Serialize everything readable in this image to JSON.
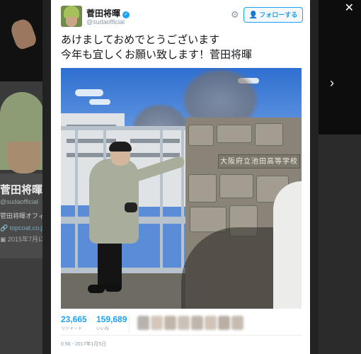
{
  "background": {
    "profile_name": "菅田将暉",
    "profile_handle": "@sudaofficial",
    "profile_bio": "菅田将暉オフィ",
    "profile_link": "topcoat.co.jp",
    "profile_joined": "2015年7月に",
    "close_icon": "close-icon",
    "next_icon": "chevron-right-icon"
  },
  "tweet": {
    "author_name": "菅田将暉",
    "author_handle": "@sudaofficial",
    "verified_icon": "verified-badge-icon",
    "settings_icon": "gear-icon",
    "follow_label": "フォローする",
    "text_line1": "あけましておめでとうございます",
    "text_line2": "今年も宜しくお願い致します！菅田将暉",
    "photo_plaque_text": "大阪府立池田高等学校",
    "retweets_count": "23,665",
    "retweets_label": "リツイート",
    "likes_count": "159,689",
    "likes_label": "いいね",
    "timestamp": "0:56 - 2017年1月5日"
  },
  "colors": {
    "accent": "#1da1f2",
    "text": "#14171a",
    "muted": "#8899a6"
  }
}
